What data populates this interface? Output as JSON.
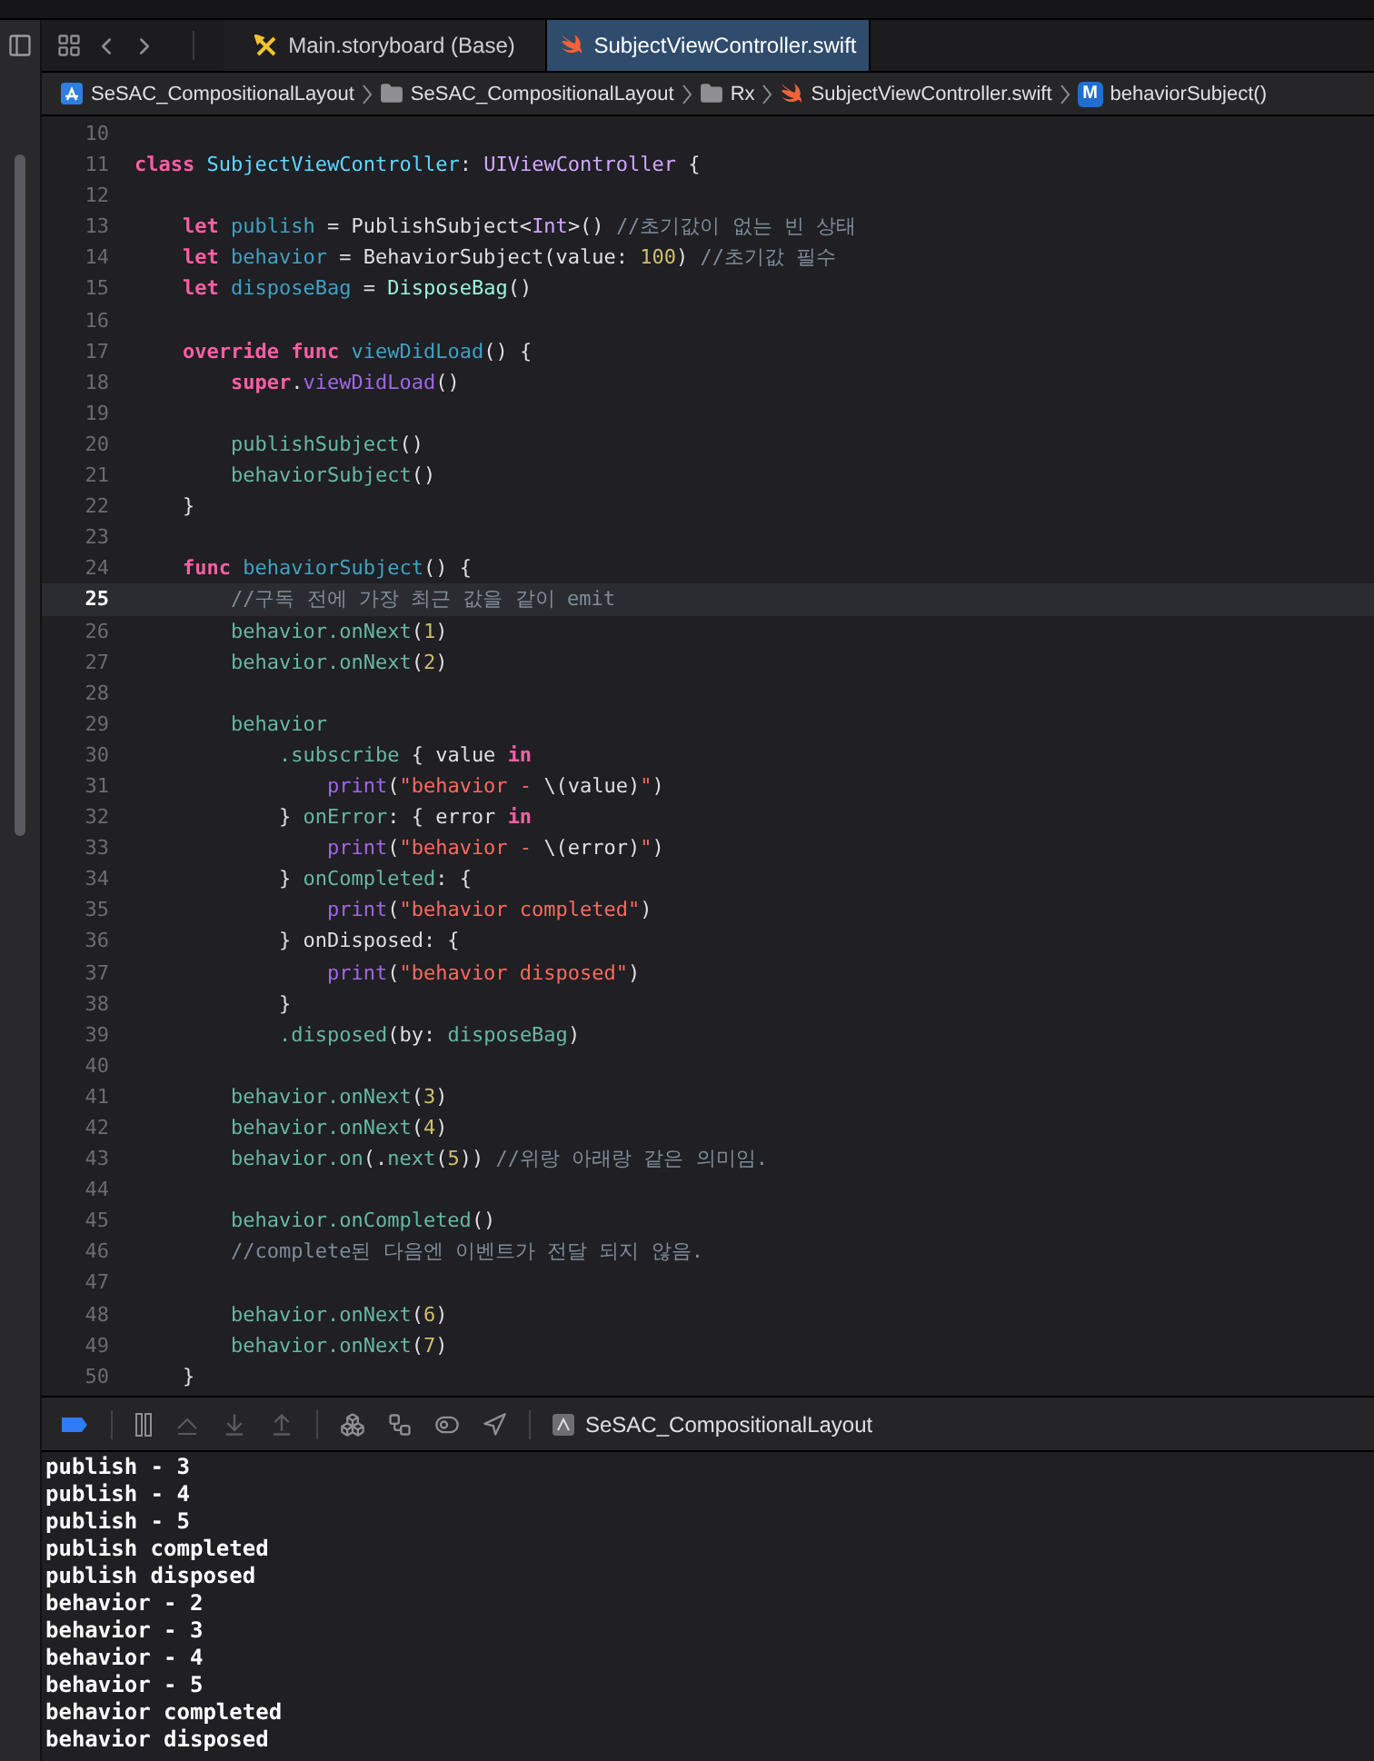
{
  "tabs": [
    {
      "label": "Main.storyboard (Base)",
      "kind": "storyboard",
      "selected": false
    },
    {
      "label": "SubjectViewController.swift",
      "kind": "swift",
      "selected": true
    }
  ],
  "breadcrumbs": [
    {
      "label": "SeSAC_CompositionalLayout",
      "kind": "project"
    },
    {
      "label": "SeSAC_CompositionalLayout",
      "kind": "folder"
    },
    {
      "label": "Rx",
      "kind": "folder"
    },
    {
      "label": "SubjectViewController.swift",
      "kind": "swift"
    },
    {
      "label": "behaviorSubject()",
      "kind": "method",
      "badge": "M"
    }
  ],
  "editor": {
    "lines": [
      {
        "number": "10",
        "current": false
      },
      {
        "number": "11",
        "current": false,
        "tokens": [
          {
            "kind": "keyword",
            "text": "class"
          },
          {
            "kind": "decl",
            "text": " SubjectViewController"
          },
          {
            "kind": "plain",
            "text": ": "
          },
          {
            "kind": "systype",
            "text": "UIViewController"
          },
          {
            "kind": "plain",
            "text": " {"
          }
        ]
      },
      {
        "number": "12",
        "current": false
      },
      {
        "number": "13",
        "current": false,
        "tokens": [
          {
            "kind": "keyword",
            "text": "    let"
          },
          {
            "kind": "property",
            "text": " publish"
          },
          {
            "kind": "plain",
            "text": " = PublishSubject<"
          },
          {
            "kind": "systype",
            "text": "Int"
          },
          {
            "kind": "plain",
            "text": ">() "
          },
          {
            "kind": "comment",
            "text": "//초기값이 없는 빈 상태"
          }
        ]
      },
      {
        "number": "14",
        "current": false,
        "tokens": [
          {
            "kind": "keyword",
            "text": "    let"
          },
          {
            "kind": "property",
            "text": " behavior"
          },
          {
            "kind": "plain",
            "text": " = BehaviorSubject(value: "
          },
          {
            "kind": "number",
            "text": "100"
          },
          {
            "kind": "plain",
            "text": ") "
          },
          {
            "kind": "comment",
            "text": "//초기값 필수"
          }
        ]
      },
      {
        "number": "15",
        "current": false,
        "tokens": [
          {
            "kind": "keyword",
            "text": "    let"
          },
          {
            "kind": "property",
            "text": " disposeBag"
          },
          {
            "kind": "plain",
            "text": " = "
          },
          {
            "kind": "projtype",
            "text": "DisposeBag"
          },
          {
            "kind": "plain",
            "text": "()"
          }
        ]
      },
      {
        "number": "16",
        "current": false
      },
      {
        "number": "17",
        "current": false,
        "tokens": [
          {
            "kind": "keyword",
            "text": "    override func"
          },
          {
            "kind": "property",
            "text": " viewDidLoad"
          },
          {
            "kind": "plain",
            "text": "() {"
          }
        ]
      },
      {
        "number": "18",
        "current": false,
        "tokens": [
          {
            "kind": "keyword",
            "text": "        super"
          },
          {
            "kind": "plain",
            "text": "."
          },
          {
            "kind": "sysmethod",
            "text": "viewDidLoad"
          },
          {
            "kind": "plain",
            "text": "()"
          }
        ]
      },
      {
        "number": "19",
        "current": false
      },
      {
        "number": "20",
        "current": false,
        "tokens": [
          {
            "kind": "method",
            "text": "        publishSubject"
          },
          {
            "kind": "plain",
            "text": "()"
          }
        ]
      },
      {
        "number": "21",
        "current": false,
        "tokens": [
          {
            "kind": "method",
            "text": "        behaviorSubject"
          },
          {
            "kind": "plain",
            "text": "()"
          }
        ]
      },
      {
        "number": "22",
        "current": false,
        "tokens": [
          {
            "kind": "plain",
            "text": "    }"
          }
        ]
      },
      {
        "number": "23",
        "current": false
      },
      {
        "number": "24",
        "current": false,
        "tokens": [
          {
            "kind": "keyword",
            "text": "    func"
          },
          {
            "kind": "property",
            "text": " behaviorSubject"
          },
          {
            "kind": "plain",
            "text": "() {"
          }
        ]
      },
      {
        "number": "25",
        "current": true,
        "tokens": [
          {
            "kind": "comment",
            "text": "        //구독 전에 가장 최근 값을 같이 emit"
          }
        ]
      },
      {
        "number": "26",
        "current": false,
        "tokens": [
          {
            "kind": "method",
            "text": "        behavior.onNext"
          },
          {
            "kind": "plain",
            "text": "("
          },
          {
            "kind": "number",
            "text": "1"
          },
          {
            "kind": "plain",
            "text": ")"
          }
        ]
      },
      {
        "number": "27",
        "current": false,
        "tokens": [
          {
            "kind": "method",
            "text": "        behavior.onNext"
          },
          {
            "kind": "plain",
            "text": "("
          },
          {
            "kind": "number",
            "text": "2"
          },
          {
            "kind": "plain",
            "text": ")"
          }
        ]
      },
      {
        "number": "28",
        "current": false
      },
      {
        "number": "29",
        "current": false,
        "tokens": [
          {
            "kind": "method",
            "text": "        behavior"
          }
        ]
      },
      {
        "number": "30",
        "current": false,
        "tokens": [
          {
            "kind": "method",
            "text": "            .subscribe"
          },
          {
            "kind": "plain",
            "text": " { value "
          },
          {
            "kind": "keyword",
            "text": "in"
          }
        ]
      },
      {
        "number": "31",
        "current": false,
        "tokens": [
          {
            "kind": "sysmethod",
            "text": "                print"
          },
          {
            "kind": "plain",
            "text": "("
          },
          {
            "kind": "string",
            "text": "\"behavior - "
          },
          {
            "kind": "plain",
            "text": "\\(value)"
          },
          {
            "kind": "string",
            "text": "\""
          },
          {
            "kind": "plain",
            "text": ")"
          }
        ]
      },
      {
        "number": "32",
        "current": false,
        "tokens": [
          {
            "kind": "plain",
            "text": "            } "
          },
          {
            "kind": "method",
            "text": "onError"
          },
          {
            "kind": "plain",
            "text": ": { error "
          },
          {
            "kind": "keyword",
            "text": "in"
          }
        ]
      },
      {
        "number": "33",
        "current": false,
        "tokens": [
          {
            "kind": "sysmethod",
            "text": "                print"
          },
          {
            "kind": "plain",
            "text": "("
          },
          {
            "kind": "string",
            "text": "\"behavior - "
          },
          {
            "kind": "plain",
            "text": "\\(error)"
          },
          {
            "kind": "string",
            "text": "\""
          },
          {
            "kind": "plain",
            "text": ")"
          }
        ]
      },
      {
        "number": "34",
        "current": false,
        "tokens": [
          {
            "kind": "plain",
            "text": "            } "
          },
          {
            "kind": "method",
            "text": "onCompleted"
          },
          {
            "kind": "plain",
            "text": ": {"
          }
        ]
      },
      {
        "number": "35",
        "current": false,
        "tokens": [
          {
            "kind": "sysmethod",
            "text": "                print"
          },
          {
            "kind": "plain",
            "text": "("
          },
          {
            "kind": "string",
            "text": "\"behavior completed\""
          },
          {
            "kind": "plain",
            "text": ")"
          }
        ]
      },
      {
        "number": "36",
        "current": false,
        "tokens": [
          {
            "kind": "plain",
            "text": "            } onDisposed: {"
          }
        ]
      },
      {
        "number": "37",
        "current": false,
        "tokens": [
          {
            "kind": "sysmethod",
            "text": "                print"
          },
          {
            "kind": "plain",
            "text": "("
          },
          {
            "kind": "string",
            "text": "\"behavior disposed\""
          },
          {
            "kind": "plain",
            "text": ")"
          }
        ]
      },
      {
        "number": "38",
        "current": false,
        "tokens": [
          {
            "kind": "plain",
            "text": "            }"
          }
        ]
      },
      {
        "number": "39",
        "current": false,
        "tokens": [
          {
            "kind": "method",
            "text": "            .disposed"
          },
          {
            "kind": "plain",
            "text": "(by: "
          },
          {
            "kind": "method",
            "text": "disposeBag"
          },
          {
            "kind": "plain",
            "text": ")"
          }
        ]
      },
      {
        "number": "40",
        "current": false
      },
      {
        "number": "41",
        "current": false,
        "tokens": [
          {
            "kind": "method",
            "text": "        behavior.onNext"
          },
          {
            "kind": "plain",
            "text": "("
          },
          {
            "kind": "number",
            "text": "3"
          },
          {
            "kind": "plain",
            "text": ")"
          }
        ]
      },
      {
        "number": "42",
        "current": false,
        "tokens": [
          {
            "kind": "method",
            "text": "        behavior.onNext"
          },
          {
            "kind": "plain",
            "text": "("
          },
          {
            "kind": "number",
            "text": "4"
          },
          {
            "kind": "plain",
            "text": ")"
          }
        ]
      },
      {
        "number": "43",
        "current": false,
        "tokens": [
          {
            "kind": "method",
            "text": "        behavior.on"
          },
          {
            "kind": "plain",
            "text": "(."
          },
          {
            "kind": "method",
            "text": "next"
          },
          {
            "kind": "plain",
            "text": "("
          },
          {
            "kind": "number",
            "text": "5"
          },
          {
            "kind": "plain",
            "text": ")) "
          },
          {
            "kind": "comment",
            "text": "//위랑 아래랑 같은 의미임."
          }
        ]
      },
      {
        "number": "44",
        "current": false
      },
      {
        "number": "45",
        "current": false,
        "tokens": [
          {
            "kind": "method",
            "text": "        behavior.onCompleted"
          },
          {
            "kind": "plain",
            "text": "()"
          }
        ]
      },
      {
        "number": "46",
        "current": false,
        "tokens": [
          {
            "kind": "comment",
            "text": "        //complete된 다음엔 이벤트가 전달 되지 않음."
          }
        ]
      },
      {
        "number": "47",
        "current": false
      },
      {
        "number": "48",
        "current": false,
        "tokens": [
          {
            "kind": "method",
            "text": "        behavior.onNext"
          },
          {
            "kind": "plain",
            "text": "("
          },
          {
            "kind": "number",
            "text": "6"
          },
          {
            "kind": "plain",
            "text": ")"
          }
        ]
      },
      {
        "number": "49",
        "current": false,
        "tokens": [
          {
            "kind": "method",
            "text": "        behavior.onNext"
          },
          {
            "kind": "plain",
            "text": "("
          },
          {
            "kind": "number",
            "text": "7"
          },
          {
            "kind": "plain",
            "text": ")"
          }
        ]
      },
      {
        "number": "50",
        "current": false,
        "tokens": [
          {
            "kind": "plain",
            "text": "    }"
          }
        ]
      }
    ]
  },
  "debug_bar": {
    "scheme": "SeSAC_CompositionalLayout"
  },
  "console": {
    "lines": [
      "publish - 3",
      "publish - 4",
      "publish - 5",
      "publish completed",
      "publish disposed",
      "behavior - 2",
      "behavior - 3",
      "behavior - 4",
      "behavior - 5",
      "behavior completed",
      "behavior disposed"
    ]
  }
}
